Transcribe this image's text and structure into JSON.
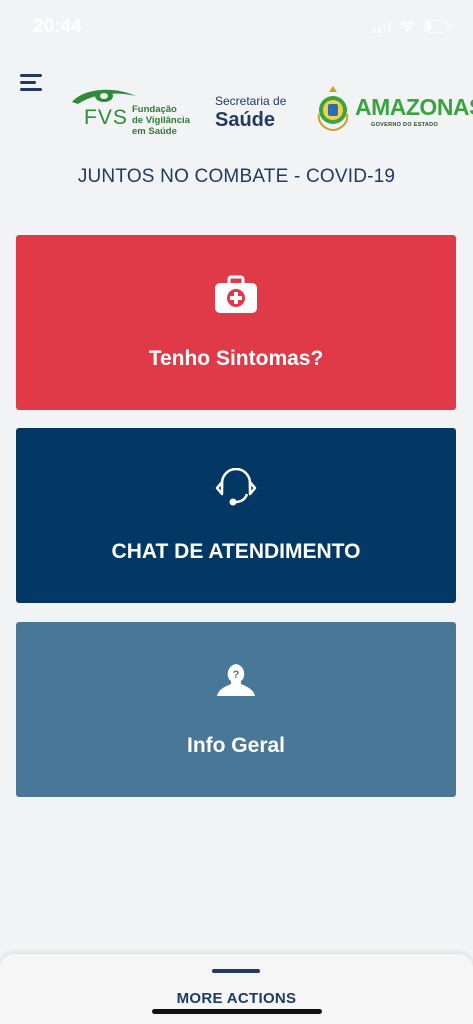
{
  "status_bar": {
    "time": "20:44",
    "signal_icon": "signal-icon",
    "wifi_icon": "wifi-icon",
    "battery_icon": "battery-icon"
  },
  "header": {
    "menu_icon": "hamburger-menu-icon",
    "logos": {
      "fvs": {
        "letters": "FVS",
        "line1": "Fundação",
        "line2": "de Vigilância",
        "line3": "em Saúde"
      },
      "secretaria": {
        "line1": "Secretaria de",
        "line2": "Saúde"
      },
      "amazonas": {
        "name": "AMAZONAS",
        "subtitle": "GOVERNO DO ESTADO"
      }
    }
  },
  "headline": "JUNTOS NO COMBATE - COVID-19",
  "cards": [
    {
      "label": "Tenho Sintomas?",
      "icon": "first-aid-kit-icon",
      "color": "#e03a48"
    },
    {
      "label": "CHAT DE ATENDIMENTO",
      "icon": "headset-icon",
      "color": "#043864"
    },
    {
      "label": "Info Geral",
      "icon": "user-question-icon",
      "color": "#487798"
    }
  ],
  "bottom_sheet": {
    "label": "MORE ACTIONS"
  },
  "colors": {
    "background": "#f2f3f4",
    "primary_text": "#1f3b63",
    "accent_green": "#3aa43f"
  }
}
